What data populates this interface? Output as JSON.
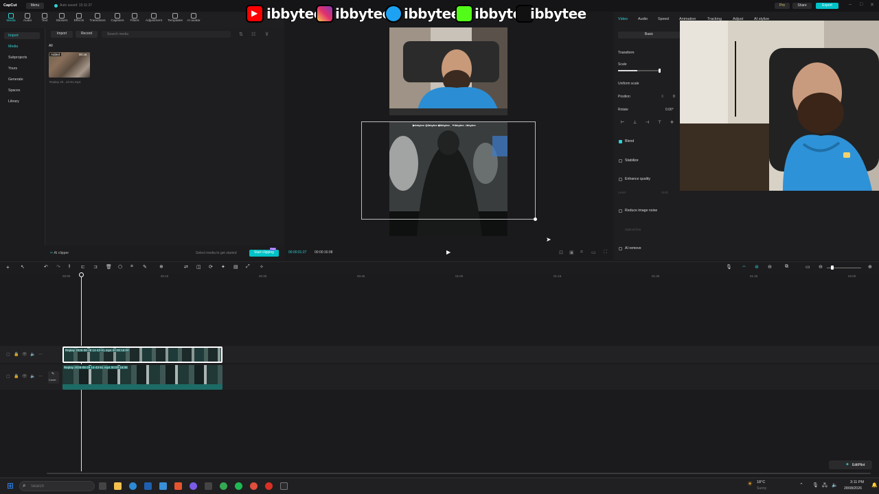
{
  "app": {
    "name": "CapCut",
    "menu_label": "Menu",
    "autosave": "Auto saved: 15:11:37",
    "pro_label": "Pro",
    "share_label": "Share",
    "export_label": "Export"
  },
  "toolbar": {
    "items": [
      "Media",
      "Audio",
      "Text",
      "Stickers",
      "Effects",
      "Transitions",
      "Captions",
      "Filters",
      "Adjustment",
      "Templates",
      "AI avatar"
    ]
  },
  "leftnav": {
    "items": [
      "Import",
      "Media",
      "Subprojects",
      "Yours",
      "Generate",
      "Spaces",
      "Library"
    ]
  },
  "media": {
    "import_label": "Import",
    "record_label": "Record",
    "search_placeholder": "Search media",
    "filter_all": "All",
    "thumb_badge": "Added",
    "thumb_duration": "00:16",
    "thumb_name": "Replay 20...43-51.mp4",
    "ai_clipper": "AI clipper",
    "hint": "Select media to get started",
    "start_clipping": "Start clipping",
    "free_badge": "Free"
  },
  "preview": {
    "current_time": "00:00:01:27",
    "total_time": "00:00:16:08"
  },
  "rightpanel": {
    "tabs": [
      "Video",
      "Audio",
      "Speed",
      "Animation",
      "Tracking",
      "Adjust",
      "AI stylize"
    ],
    "basic_label": "Basic",
    "transform_label": "Transform",
    "scale_label": "Scale",
    "scale_value": 0.45,
    "uniform_scale": "Uniform scale",
    "position_label": "Position",
    "position_x": "X",
    "position_value": "0",
    "rotate_label": "Rotate",
    "rotate_value": "0.00°",
    "blend": "Blend",
    "stabilize": "Stabilize",
    "enhance_quality": "Enhance quality",
    "level_label": "Level",
    "level_value": "UHD",
    "reduce_noise": "Reduce image noise",
    "optical_flow": "Optical flow",
    "ai_remove": "AI remove"
  },
  "timeline": {
    "ruler": [
      "00:00",
      "00:15",
      "00:30",
      "00:45",
      "01:00",
      "01:15",
      "01:30",
      "01:45",
      "02:00",
      "02:15",
      "02:30",
      "02:45",
      "03:00"
    ],
    "clip1_label": "Replay 2026-08-28 14-43-51.mp4   00:00:16:08",
    "clip2_label": "Replay 2026-08-28 14-43-51.mp4   00:00:16:08",
    "cover_label": "Cover",
    "editpilot": "EditPilot"
  },
  "social": {
    "handles": [
      "ibbytee",
      "ibbytee",
      "ibbytee_",
      "ibbytee",
      "ibbytee"
    ]
  },
  "taskbar": {
    "search_placeholder": "Search",
    "weather_temp": "18°C",
    "weather_desc": "Sunny",
    "time": "3:11 PM",
    "date": "28/08/2026"
  },
  "colors": {
    "accent": "#2fd3d3",
    "export_bg": "#00c2c7",
    "clip1": "#1f5a56",
    "clip2": "#1d6b66"
  }
}
